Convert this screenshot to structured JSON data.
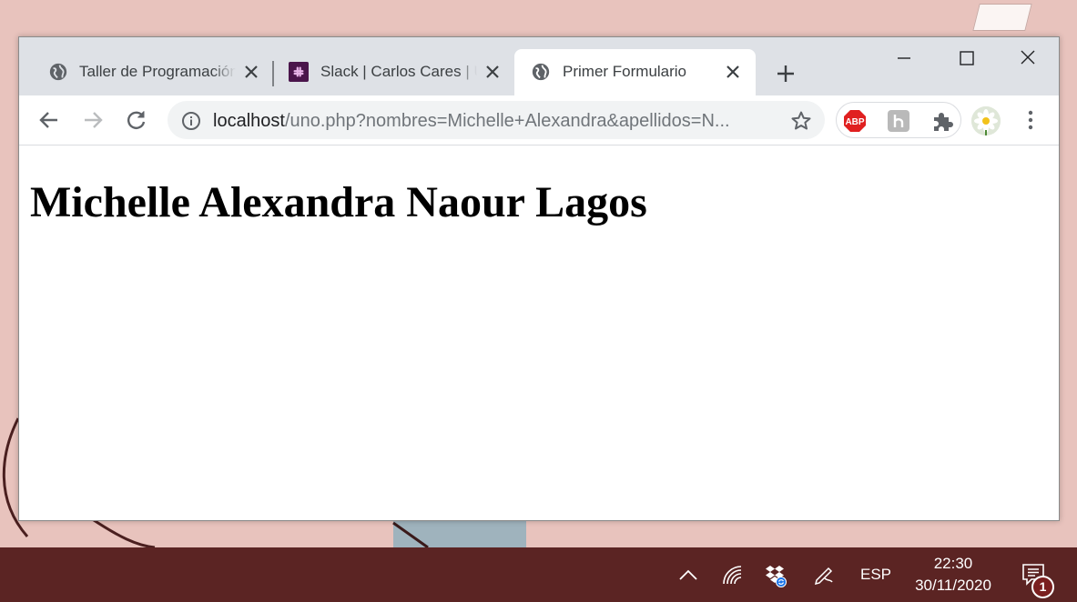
{
  "browser": {
    "tabs": [
      {
        "title": "Taller de Programación",
        "icon": "globe-icon",
        "active": false
      },
      {
        "title": "Slack | Carlos Cares | Un",
        "icon": "slack-icon",
        "active": false
      },
      {
        "title": "Primer Formulario",
        "icon": "globe-icon",
        "active": true
      }
    ],
    "address": {
      "host": "localhost",
      "path": "/uno.php?nombres=Michelle+Alexandra&apellidos=N..."
    },
    "extensions": [
      "abp-icon",
      "h-extension-icon",
      "puzzle-icon"
    ],
    "abp_label": "ABP"
  },
  "page": {
    "heading": "Michelle Alexandra Naour Lagos"
  },
  "taskbar": {
    "language": "ESP",
    "time": "22:30",
    "date": "30/11/2020",
    "notification_count": "1"
  },
  "colors": {
    "taskbar": "#5b2423",
    "tabstrip": "#dee1e6",
    "wallpaper": "#e8c3bd",
    "abp_red": "#e02020",
    "slack_purple": "#4a154b"
  }
}
